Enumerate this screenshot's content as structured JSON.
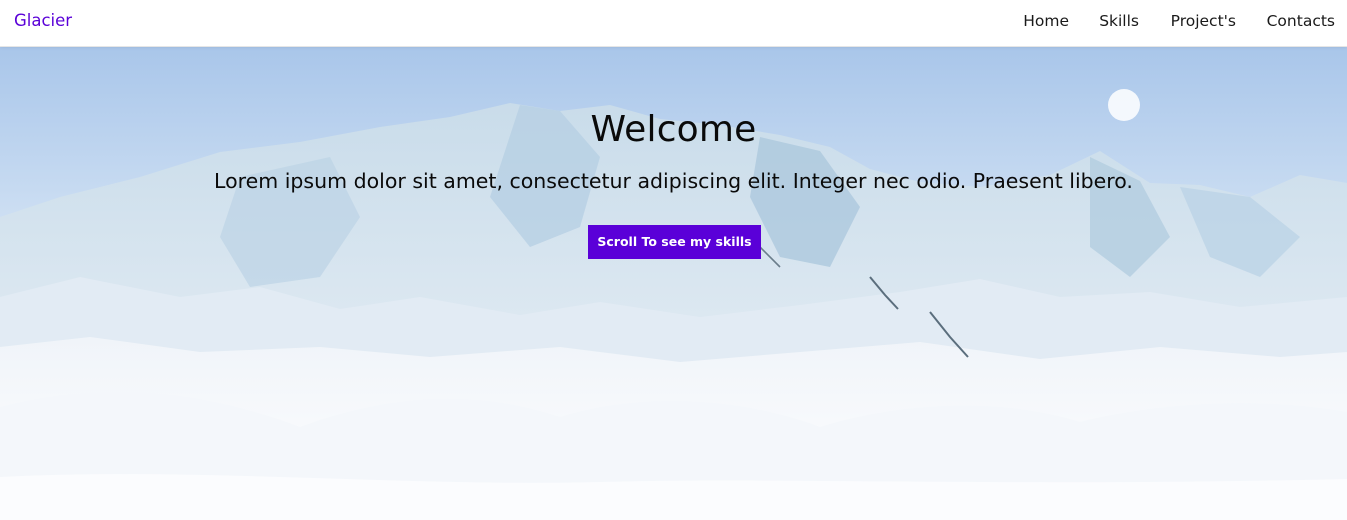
{
  "navbar": {
    "brand": "Glacier",
    "links": [
      {
        "label": "Home"
      },
      {
        "label": "Skills"
      },
      {
        "label": "Project's"
      },
      {
        "label": "Contacts"
      }
    ]
  },
  "hero": {
    "title": "Welcome",
    "subtitle": "Lorem ipsum dolor sit amet, consectetur adipiscing elit. Integer nec odio. Praesent libero.",
    "button_label": "Scroll To see my skills",
    "background_description_icon": "glacier-landscape-image"
  },
  "colors": {
    "accent": "#5a00d8",
    "nav_text": "#1a1a1a",
    "hero_text": "#0a0a0a",
    "button_text": "#ffffff"
  }
}
